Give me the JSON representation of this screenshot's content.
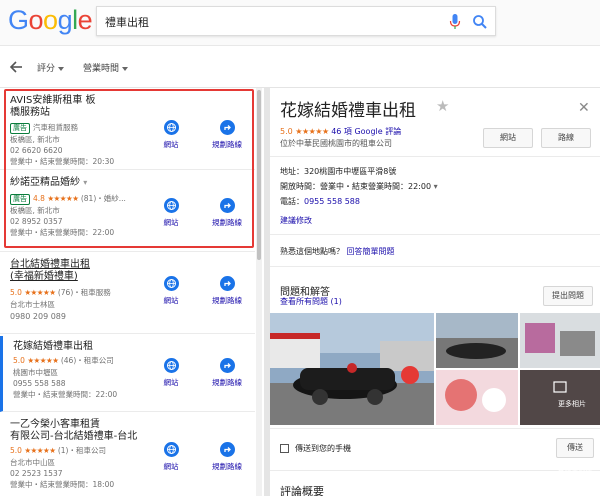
{
  "search": {
    "query": "禮車出租"
  },
  "logo": {
    "letters": [
      "G",
      "o",
      "o",
      "g",
      "l",
      "e"
    ]
  },
  "filters": {
    "rating": "評分",
    "hours": "營業時間"
  },
  "actions": {
    "website": "網站",
    "directions": "規劃路線"
  },
  "results": [
    {
      "name_line1": "AVIS安維斯租車 板",
      "name_line2": "橋服務站",
      "ad": "廣告",
      "category": "汽車租賃服務",
      "location": "板橋區, 新北市",
      "phone": "02 6620 6620",
      "hours": "營業中・結束營業時間：20:30"
    },
    {
      "name_line1": "紗諾亞精品婚紗",
      "ad": "廣告",
      "rating": "4.8",
      "stars": "★★★★★",
      "review_count": "(81)",
      "category": "・婚紗...",
      "location": "板橋區, 新北市",
      "phone": "02 8952 0357",
      "hours": "營業中・結束營業時間：22:00"
    },
    {
      "name_line1": "台北結婚禮車出租",
      "name_line2": "(幸福新婚禮車)",
      "rating": "5.0",
      "stars": "★★★★★",
      "review_count": "(76)",
      "category": "・租車服務",
      "location": "台北市士林區",
      "phone": "0980 209 089"
    },
    {
      "name_line1": "花嫁結婚禮車出租",
      "rating": "5.0",
      "stars": "★★★★★",
      "review_count": "(46)",
      "category": "・租車公司",
      "location": "桃園市中壢區",
      "phone": "0955 558 588",
      "hours": "營業中・結束營業時間：22:00"
    },
    {
      "name_line1": "一乙今榮小客車租賃",
      "name_line2": "有限公司-台北結婚禮車-台北",
      "rating": "5.0",
      "stars": "★★★★★",
      "review_count": "(1)",
      "category": "・租車公司",
      "location": "台北市中山區",
      "phone": "02 2523 1537",
      "hours": "營業中・結束營業時間：18:00"
    }
  ],
  "detail": {
    "title": "花嫁結婚禮車出租",
    "rating": "5.0",
    "stars": "★★★★★",
    "review_link": "46 項 Google 評論",
    "subtitle": "位於中華民國桃園市的租車公司",
    "website_btn": "網站",
    "directions_btn": "路線",
    "address_label": "地址：",
    "address": "320桃園市中壢區平滑8號",
    "hours_label": "開放時間：",
    "hours_value": "營業中・結束營業時間：22:00",
    "phone_label": "電話：",
    "phone": "0955 558 588",
    "suggest_edit": "建議修改",
    "owner_question": "熟悉這個地點嗎？",
    "owner_link": "回答簡單問題",
    "qa_title": "問題和解答",
    "qa_link": "查看所有問題 (1)",
    "ask_btn": "提出問題",
    "more_photos": "更多相片",
    "send_label": "傳送到您的手機",
    "send_btn": "傳送",
    "reviews_title": "評論概要"
  },
  "colors": {
    "accent": "#1a73e8",
    "star": "#e7711b",
    "highlight": "#e53935",
    "link": "#1a0dab"
  },
  "watermark": "電腦王阿達"
}
